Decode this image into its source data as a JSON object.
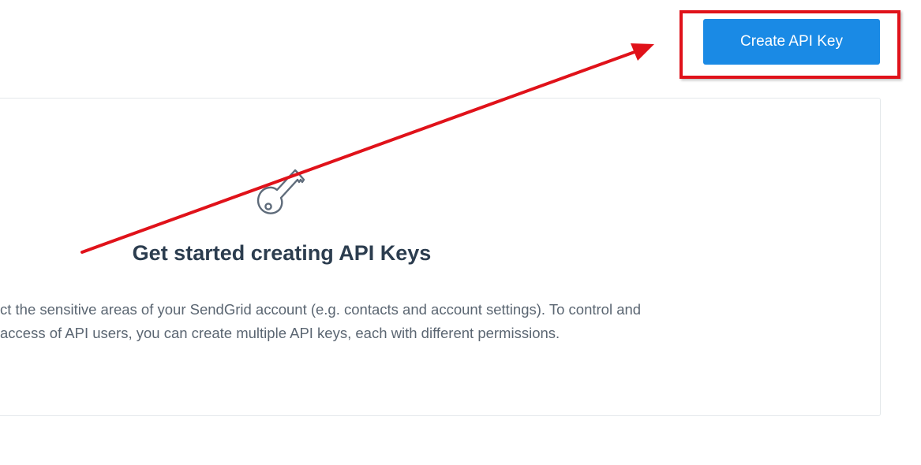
{
  "header": {
    "create_button_label": "Create API Key"
  },
  "empty_state": {
    "icon": "key-icon",
    "title": "Get started creating API Keys",
    "description_lines": [
      "ct the sensitive areas of your SendGrid account (e.g. contacts and account settings). To control and",
      "access of API users, you can create multiple API keys, each with different permissions."
    ]
  },
  "annotation": {
    "color": "#e0121a",
    "target": "create-api-key-button"
  },
  "colors": {
    "primary_button": "#1a8ae5",
    "title_text": "#2c3d4f",
    "body_text": "#5b6672",
    "icon_stroke": "#5e6b7a"
  }
}
